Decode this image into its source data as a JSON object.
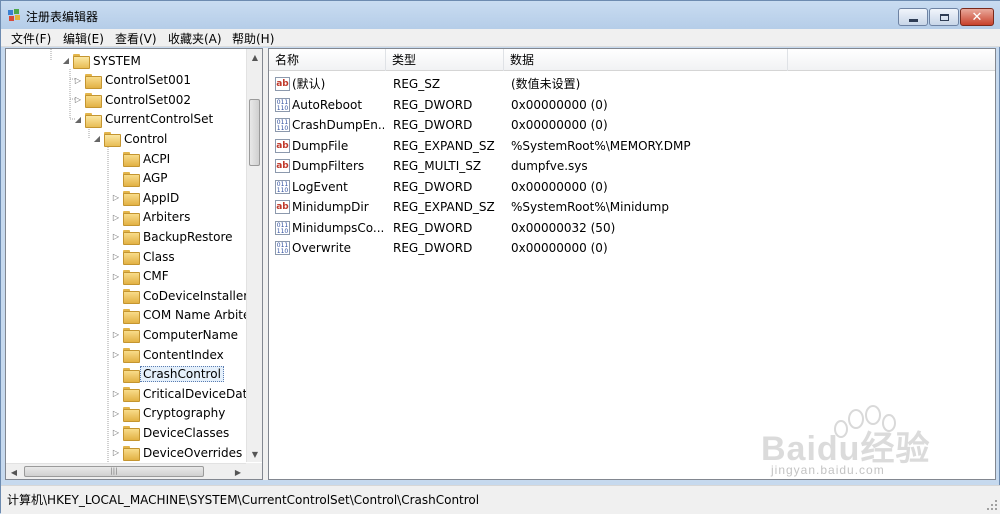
{
  "window": {
    "title": "注册表编辑器"
  },
  "menu": [
    "文件(F)",
    "编辑(E)",
    "查看(V)",
    "收藏夹(A)",
    "帮助(H)"
  ],
  "tree": [
    {
      "label": "SYSTEM",
      "level": 0,
      "arrow": "◢",
      "open": true
    },
    {
      "label": "ControlSet001",
      "level": 1,
      "arrow": "▷"
    },
    {
      "label": "ControlSet002",
      "level": 1,
      "arrow": "▷"
    },
    {
      "label": "CurrentControlSet",
      "level": 1,
      "arrow": "◢",
      "open": true
    },
    {
      "label": "Control",
      "level": 2,
      "arrow": "◢",
      "open": true
    },
    {
      "label": "ACPI",
      "level": 3,
      "arrow": ""
    },
    {
      "label": "AGP",
      "level": 3,
      "arrow": ""
    },
    {
      "label": "AppID",
      "level": 3,
      "arrow": "▷"
    },
    {
      "label": "Arbiters",
      "level": 3,
      "arrow": "▷"
    },
    {
      "label": "BackupRestore",
      "level": 3,
      "arrow": "▷"
    },
    {
      "label": "Class",
      "level": 3,
      "arrow": "▷"
    },
    {
      "label": "CMF",
      "level": 3,
      "arrow": "▷"
    },
    {
      "label": "CoDeviceInstallers",
      "level": 3,
      "arrow": ""
    },
    {
      "label": "COM Name Arbiter",
      "level": 3,
      "arrow": ""
    },
    {
      "label": "ComputerName",
      "level": 3,
      "arrow": "▷"
    },
    {
      "label": "ContentIndex",
      "level": 3,
      "arrow": "▷"
    },
    {
      "label": "CrashControl",
      "level": 3,
      "arrow": "",
      "selected": true
    },
    {
      "label": "CriticalDeviceData",
      "level": 3,
      "arrow": "▷"
    },
    {
      "label": "Cryptography",
      "level": 3,
      "arrow": "▷"
    },
    {
      "label": "DeviceClasses",
      "level": 3,
      "arrow": "▷"
    },
    {
      "label": "DeviceOverrides",
      "level": 3,
      "arrow": "▷"
    }
  ],
  "columns": {
    "name": "名称",
    "type": "类型",
    "data": "数据"
  },
  "values": [
    {
      "icon": "string-value-icon",
      "name": "(默认)",
      "type": "REG_SZ",
      "data": "(数值未设置)"
    },
    {
      "icon": "binary-value-icon",
      "name": "AutoReboot",
      "type": "REG_DWORD",
      "data": "0x00000000 (0)"
    },
    {
      "icon": "binary-value-icon",
      "name": "CrashDumpEn...",
      "type": "REG_DWORD",
      "data": "0x00000000 (0)"
    },
    {
      "icon": "string-value-icon",
      "name": "DumpFile",
      "type": "REG_EXPAND_SZ",
      "data": "%SystemRoot%\\MEMORY.DMP"
    },
    {
      "icon": "string-value-icon",
      "name": "DumpFilters",
      "type": "REG_MULTI_SZ",
      "data": "dumpfve.sys"
    },
    {
      "icon": "binary-value-icon",
      "name": "LogEvent",
      "type": "REG_DWORD",
      "data": "0x00000000 (0)"
    },
    {
      "icon": "string-value-icon",
      "name": "MinidumpDir",
      "type": "REG_EXPAND_SZ",
      "data": "%SystemRoot%\\Minidump"
    },
    {
      "icon": "binary-value-icon",
      "name": "MinidumpsCo...",
      "type": "REG_DWORD",
      "data": "0x00000032 (50)"
    },
    {
      "icon": "binary-value-icon",
      "name": "Overwrite",
      "type": "REG_DWORD",
      "data": "0x00000000 (0)"
    }
  ],
  "status": {
    "path": "计算机\\HKEY_LOCAL_MACHINE\\SYSTEM\\CurrentControlSet\\Control\\CrashControl"
  },
  "watermark": {
    "brand": "Baidu经验",
    "url": "jingyan.baidu.com"
  },
  "colors": {
    "title_bar": "#c9dcf1",
    "selection": "#e5f0fb",
    "close_button": "#c8412b"
  }
}
